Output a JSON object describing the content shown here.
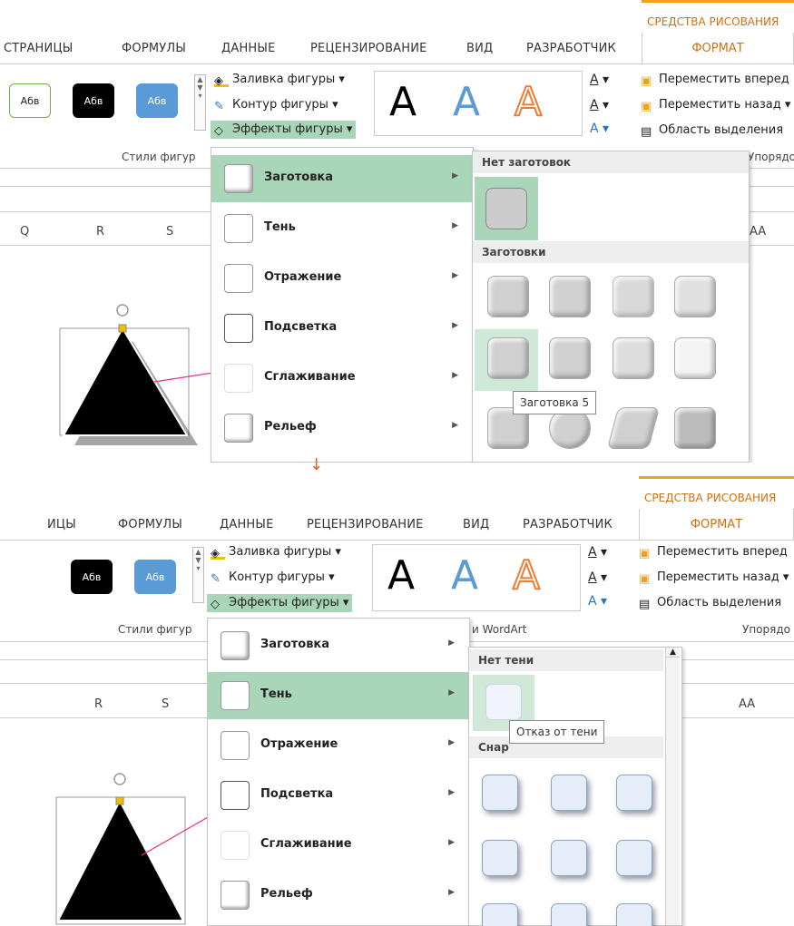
{
  "step1": {
    "tool_context": "СРЕДСТВА РИСОВАНИЯ",
    "tabs": [
      "СТРАНИЦЫ",
      "ФОРМУЛЫ",
      "ДАННЫЕ",
      "РЕЦЕНЗИРОВАНИЕ",
      "ВИД",
      "РАЗРАБОТЧИК"
    ],
    "active_tab": "ФОРМАТ",
    "style_presets": [
      "Абв",
      "Абв",
      "Абв"
    ],
    "shape_commands": {
      "fill": "Заливка фигуры",
      "outline": "Контур фигуры",
      "effects": "Эффекты фигуры"
    },
    "wordart_letters": [
      "A",
      "A",
      "A"
    ],
    "arrange": {
      "forward": "Переместить вперед",
      "backward": "Переместить назад",
      "selection": "Область выделения",
      "group_label": "Упорядо"
    },
    "group_label_styles": "Стили фигур",
    "columns": [
      "Q",
      "R",
      "S",
      "AA"
    ],
    "menu_items": [
      "Заготовка",
      "Тень",
      "Отражение",
      "Подсветка",
      "Сглаживание",
      "Рельеф"
    ],
    "gallery": {
      "header_none": "Нет заготовок",
      "header_presets": "Заготовки",
      "tooltip": "Заготовка 5"
    }
  },
  "step2": {
    "tool_context": "СРЕДСТВА РИСОВАНИЯ",
    "tabs": [
      "ИЦЫ",
      "ФОРМУЛЫ",
      "ДАННЫЕ",
      "РЕЦЕНЗИРОВАНИЕ",
      "ВИД",
      "РАЗРАБОТЧИК"
    ],
    "active_tab": "ФОРМАТ",
    "style_presets": [
      "Абв",
      "Абв"
    ],
    "shape_commands": {
      "fill": "Заливка фигуры",
      "outline": "Контур фигуры",
      "effects": "Эффекты фигуры"
    },
    "wordart_letters": [
      "A",
      "A",
      "A"
    ],
    "arrange": {
      "forward": "Переместить вперед",
      "backward": "Переместить назад",
      "selection": "Область выделения",
      "group_label": "Упорядо"
    },
    "group_label_styles": "Стили фигур",
    "group_label_wordart": "и WordArt",
    "columns": [
      "R",
      "S",
      "AA"
    ],
    "menu_items": [
      "Заготовка",
      "Тень",
      "Отражение",
      "Подсветка",
      "Сглаживание",
      "Рельеф"
    ],
    "gallery": {
      "header_none": "Нет тени",
      "header_outer": "Снар",
      "tooltip": "Отказ от тени"
    }
  },
  "colors": {
    "accent": "#d07010",
    "highlight": "#a9d6b8",
    "connector": "#e8308a"
  }
}
